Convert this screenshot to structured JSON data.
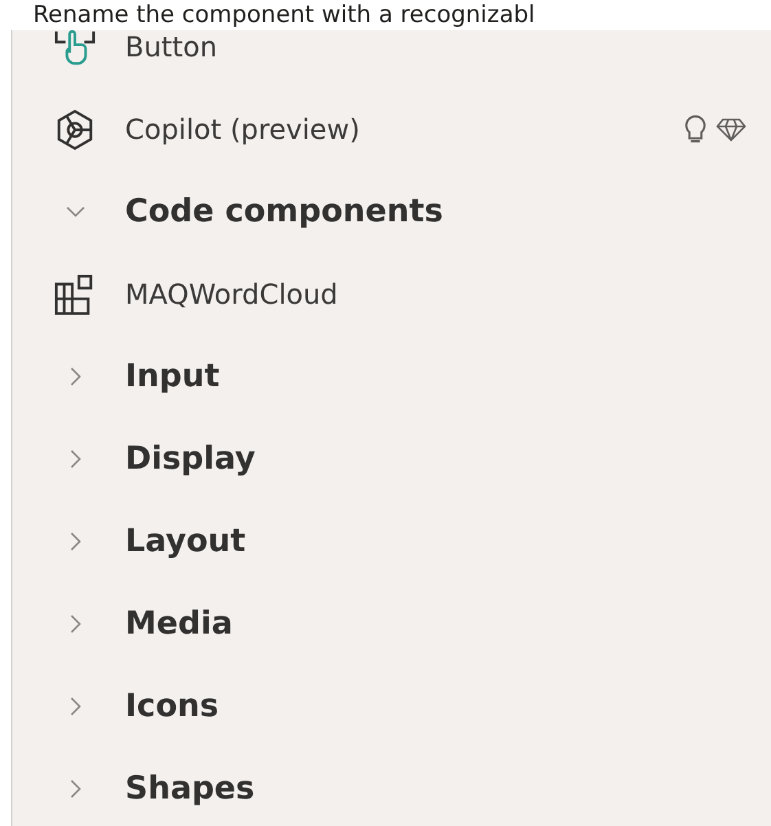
{
  "header_text": "Rename the component with a recognizabl",
  "items": [
    {
      "kind": "button",
      "label": "Button"
    },
    {
      "kind": "copilot",
      "label": "Copilot (preview)"
    },
    {
      "kind": "category",
      "label": "Code components",
      "expanded": true
    },
    {
      "kind": "component",
      "label": "MAQWordCloud"
    },
    {
      "kind": "category",
      "label": "Input",
      "expanded": false
    },
    {
      "kind": "category",
      "label": "Display",
      "expanded": false
    },
    {
      "kind": "category",
      "label": "Layout",
      "expanded": false
    },
    {
      "kind": "category",
      "label": "Media",
      "expanded": false
    },
    {
      "kind": "category",
      "label": "Icons",
      "expanded": false
    },
    {
      "kind": "category",
      "label": "Shapes",
      "expanded": false
    }
  ]
}
